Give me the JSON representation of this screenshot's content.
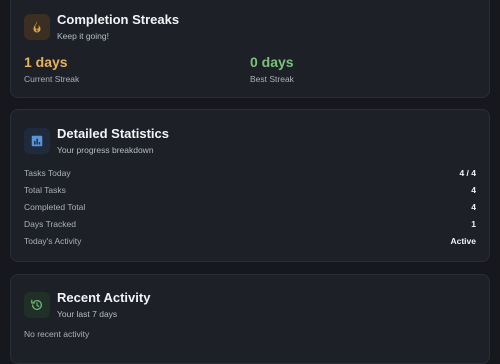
{
  "colors": {
    "current_streak": "#e8b25a",
    "best_streak": "#79c27b",
    "fire_icon": "#e0a447",
    "chart_icon": "#5b95d8",
    "history_icon": "#6fb27a"
  },
  "streaks": {
    "icon": "fire-icon",
    "title": "Completion Streaks",
    "subtitle": "Keep it going!",
    "current": {
      "value": "1 days",
      "label": "Current Streak"
    },
    "best": {
      "value": "0 days",
      "label": "Best Streak"
    }
  },
  "stats": {
    "icon": "bar-chart-icon",
    "title": "Detailed Statistics",
    "subtitle": "Your progress breakdown",
    "rows": [
      {
        "label": "Tasks Today",
        "value": "4 / 4"
      },
      {
        "label": "Total Tasks",
        "value": "4"
      },
      {
        "label": "Completed Total",
        "value": "4"
      },
      {
        "label": "Days Tracked",
        "value": "1"
      },
      {
        "label": "Today's Activity",
        "value": "Active"
      }
    ]
  },
  "activity": {
    "icon": "history-icon",
    "title": "Recent Activity",
    "subtitle": "Your last 7 days",
    "empty_text": "No recent activity"
  }
}
